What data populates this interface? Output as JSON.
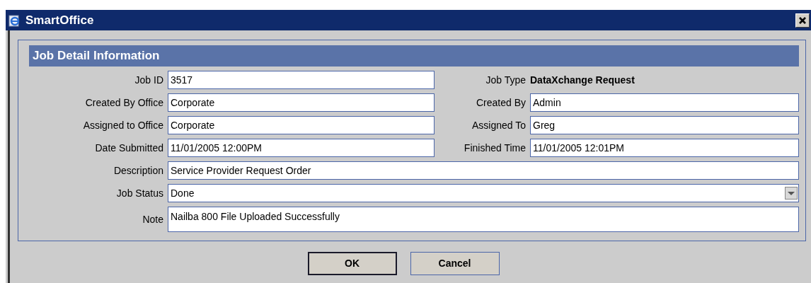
{
  "window": {
    "title": "SmartOffice"
  },
  "panel": {
    "title": "Job Detail Information"
  },
  "rows": [
    {
      "cells": [
        {
          "label": "Job ID",
          "kind": "input",
          "value": "3517"
        },
        {
          "label": "Job Type",
          "kind": "text",
          "value": "DataXchange Request"
        }
      ]
    },
    {
      "cells": [
        {
          "label": "Created By Office",
          "kind": "input",
          "value": "Corporate"
        },
        {
          "label": "Created By",
          "kind": "input",
          "value": "Admin"
        }
      ]
    },
    {
      "cells": [
        {
          "label": "Assigned to Office",
          "kind": "input",
          "value": "Corporate"
        },
        {
          "label": "Assigned To",
          "kind": "input",
          "value": "Greg"
        }
      ]
    },
    {
      "cells": [
        {
          "label": "Date Submitted",
          "kind": "input",
          "value": "11/01/2005 12:00PM"
        },
        {
          "label": "Finished Time",
          "kind": "input",
          "value": "11/01/2005 12:01PM"
        }
      ]
    },
    {
      "cells": [
        {
          "label": "Description",
          "kind": "input",
          "value": "Service Provider Request Order"
        }
      ]
    },
    {
      "cells": [
        {
          "label": "Job Status",
          "kind": "select",
          "value": "Done"
        }
      ]
    },
    {
      "cells": [
        {
          "label": "Note",
          "kind": "textarea",
          "value": "Nailba 800 File Uploaded Successfully"
        }
      ]
    }
  ],
  "buttons": [
    {
      "label": "OK",
      "default": true
    },
    {
      "label": "Cancel",
      "default": false
    }
  ]
}
